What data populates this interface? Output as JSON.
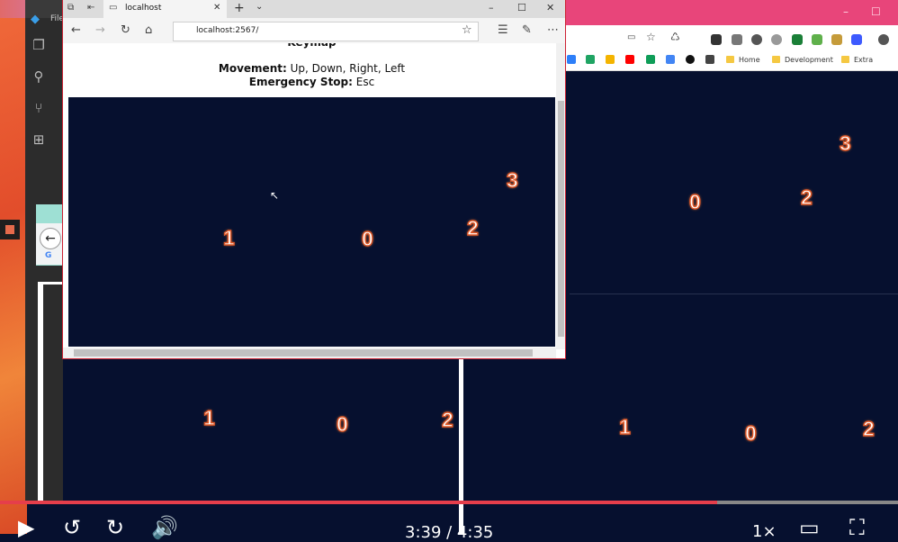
{
  "vscode": {
    "file_label": "File"
  },
  "right_chrome": {
    "bookmarks": [
      "Home",
      "Development",
      "Extra"
    ],
    "numbers": [
      "3",
      "0",
      "2"
    ]
  },
  "edge": {
    "tab_title": "localhost",
    "url": "localhost:2567/",
    "keymap_title": "Keymap",
    "movement_label": "Movement:",
    "movement_value": "Up, Down, Right, Left",
    "stop_label": "Emergency Stop:",
    "stop_value": "Esc",
    "canvas_numbers": [
      "1",
      "0",
      "2",
      "3"
    ]
  },
  "lower_left_numbers": [
    "1",
    "0",
    "2"
  ],
  "lower_right_numbers": [
    "1",
    "0",
    "2"
  ],
  "video": {
    "time": "3:39 / 4:35",
    "speed": "1×",
    "progress": 0.799
  }
}
